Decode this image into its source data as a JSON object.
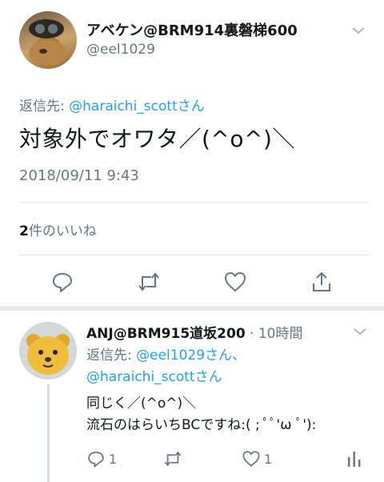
{
  "main_tweet": {
    "display_name": "アベケン@BRM914裏磐梯600",
    "handle": "@eel1029",
    "reply_prefix": "返信先: ",
    "reply_to": "@haraichi_scottさん",
    "text": "対象外でオワタ／(^o^)＼",
    "datetime": "2018/09/11 9:43",
    "like_count": "2",
    "like_label": "件のいいね"
  },
  "reply_tweet": {
    "display_name": "ANJ@BRM915道坂200",
    "time": " · 10時間",
    "reply_prefix": "返信先: ",
    "reply_to_1": "@eel1029さん、",
    "reply_to_2": "@haraichi_scottさん",
    "line_1": "同じく／(^o^)＼",
    "line_2": "流石のはらいちBCですね:( ; ﾟﾟ'ω ﾟ'):",
    "reply_count": "1",
    "like_count": "1"
  },
  "icons": {
    "caret": "chevron-down-icon",
    "reply": "reply-icon",
    "retweet": "retweet-icon",
    "like": "heart-icon",
    "share": "share-icon",
    "analytics": "analytics-icon"
  },
  "colors": {
    "accent": "#1da1f2",
    "secondary_text": "#657786",
    "icon": "#657786"
  }
}
